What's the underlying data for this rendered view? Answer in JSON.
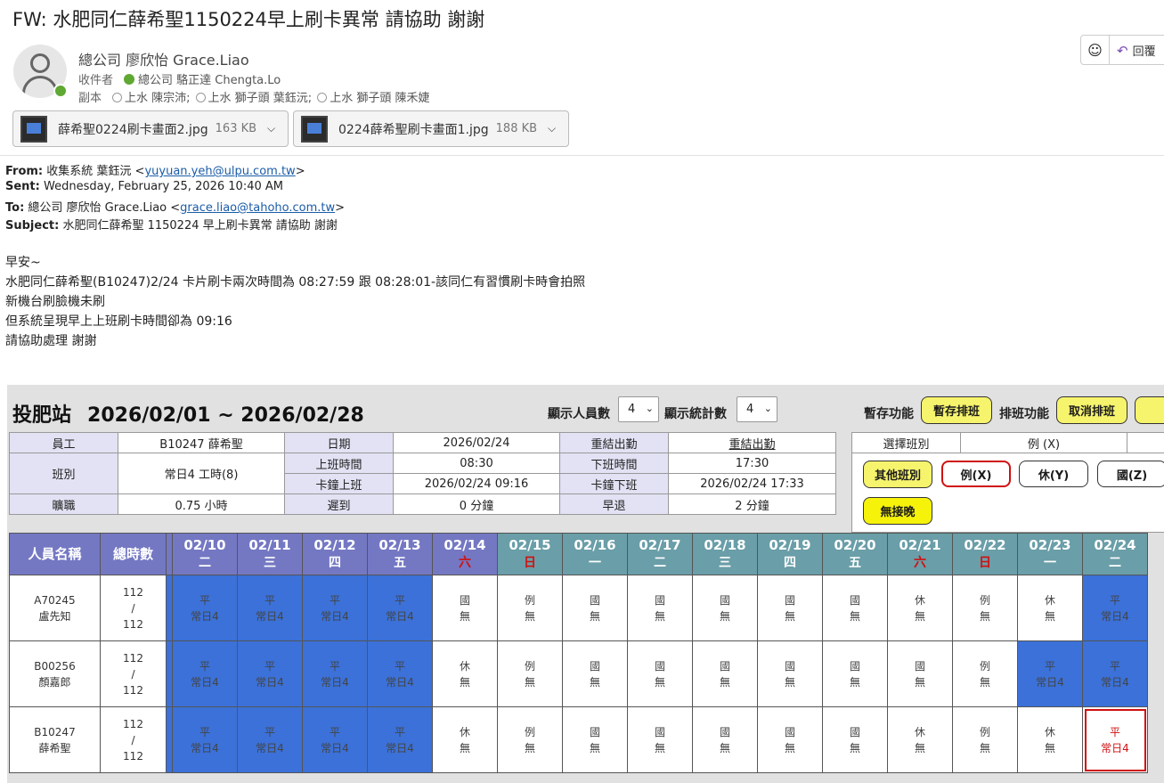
{
  "email": {
    "subject": "FW: 水肥同仁薛希聖1150224早上刷卡異常 請協助 謝謝",
    "sender": "總公司 廖欣怡 Grace.Liao",
    "to_label": "收件者",
    "to": "總公司 駱正達 Chengta.Lo",
    "cc_label": "副本",
    "cc": [
      "上水 陳宗沛;",
      "上水 獅子頭 葉鈺沅;",
      "上水 獅子頭 陳禾婕"
    ],
    "reply_label": "回覆",
    "attachments": [
      {
        "name": "薛希聖0224刷卡畫面2.jpg",
        "size": "163 KB"
      },
      {
        "name": "0224薛希聖刷卡畫面1.jpg",
        "size": "188 KB"
      }
    ],
    "fwd": {
      "from_label": "From:",
      "from_name": "收集系統 葉鈺沅 <",
      "from_email": "yuyuan.yeh@ulpu.com.tw",
      "from_end": ">",
      "sent_label": "Sent:",
      "sent": "Wednesday, February 25, 2026 10:40 AM",
      "to_label": "To:",
      "to_name": "總公司 廖欣怡 Grace.Liao <",
      "to_email": "grace.liao@tahoho.com.tw",
      "to_end": ">",
      "subj_label": "Subject:",
      "subj": "水肥同仁薛希聖 1150224 早上刷卡異常 請協助 謝謝"
    },
    "body": [
      "早安~",
      "水肥同仁薛希聖(B10247)2/24 卡片刷卡兩次時間為 08:27:59 跟 08:28:01-該同仁有習慣刷卡時會拍照",
      "新機台刷臉機未刷",
      "但系統呈現早上上班刷卡時間卻為 09:16",
      "請協助處理 謝謝"
    ]
  },
  "panel": {
    "station": "投肥站",
    "range": "2026/02/01 ~ 2026/02/28",
    "show_people_label": "顯示人員數",
    "show_people_value": "4",
    "show_stats_label": "顯示統計數",
    "show_stats_value": "4",
    "temp_label": "暫存功能",
    "temp_btn": "暫存排班",
    "sched_label": "排班功能",
    "sched_btn": "取消排班",
    "info": {
      "emp_h": "員工",
      "emp": "B10247 薛希聖",
      "date_h": "日期",
      "date": "2026/02/24",
      "reset_h": "重結出勤",
      "reset": "重結出勤",
      "shift_h": "班別",
      "shift": "常日4 工時(8)",
      "on_h": "上班時間",
      "on": "08:30",
      "off_h": "下班時間",
      "off": "17:30",
      "cardon_h": "卡鐘上班",
      "cardon": "2026/02/24 09:16",
      "cardoff_h": "卡鐘下班",
      "cardoff": "2026/02/24 17:33",
      "absent_h": "曠職",
      "absent": "0.75 小時",
      "late_h": "遲到",
      "late": "0 分鐘",
      "early_h": "早退",
      "early": "2 分鐘"
    },
    "select_h": "選擇班別",
    "select_v": "例 (X)",
    "shift_btns": {
      "other": "其他班別",
      "x": "例(X)",
      "y": "休(Y)",
      "z": "國(Z)",
      "night": "無接晚"
    },
    "grid": {
      "name_h": "人員名稱",
      "hours_h": "總時數",
      "dates": [
        {
          "d": "02/10",
          "w": "二"
        },
        {
          "d": "02/11",
          "w": "三"
        },
        {
          "d": "02/12",
          "w": "四"
        },
        {
          "d": "02/13",
          "w": "五"
        },
        {
          "d": "02/14",
          "w": "六"
        },
        {
          "d": "02/15",
          "w": "日"
        },
        {
          "d": "02/16",
          "w": "一"
        },
        {
          "d": "02/17",
          "w": "二"
        },
        {
          "d": "02/18",
          "w": "三"
        },
        {
          "d": "02/19",
          "w": "四"
        },
        {
          "d": "02/20",
          "w": "五"
        },
        {
          "d": "02/21",
          "w": "六"
        },
        {
          "d": "02/22",
          "w": "日"
        },
        {
          "d": "02/23",
          "w": "一"
        },
        {
          "d": "02/24",
          "w": "二"
        }
      ],
      "rows": [
        {
          "id": "A70245",
          "name": "盧先知",
          "h1": "112",
          "slash": "/",
          "h2": "112",
          "cells": [
            [
              "平",
              "常日4"
            ],
            [
              "平",
              "常日4"
            ],
            [
              "平",
              "常日4"
            ],
            [
              "平",
              "常日4"
            ],
            [
              "國",
              "無"
            ],
            [
              "例",
              "無"
            ],
            [
              "國",
              "無"
            ],
            [
              "國",
              "無"
            ],
            [
              "國",
              "無"
            ],
            [
              "國",
              "無"
            ],
            [
              "國",
              "無"
            ],
            [
              "休",
              "無"
            ],
            [
              "例",
              "無"
            ],
            [
              "休",
              "無"
            ],
            [
              "平",
              "常日4"
            ]
          ]
        },
        {
          "id": "B00256",
          "name": "顏嘉郎",
          "h1": "112",
          "slash": "/",
          "h2": "112",
          "cells": [
            [
              "平",
              "常日4"
            ],
            [
              "平",
              "常日4"
            ],
            [
              "平",
              "常日4"
            ],
            [
              "平",
              "常日4"
            ],
            [
              "休",
              "無"
            ],
            [
              "例",
              "無"
            ],
            [
              "國",
              "無"
            ],
            [
              "國",
              "無"
            ],
            [
              "國",
              "無"
            ],
            [
              "國",
              "無"
            ],
            [
              "國",
              "無"
            ],
            [
              "國",
              "無"
            ],
            [
              "例",
              "無"
            ],
            [
              "平",
              "常日4"
            ],
            [
              "平",
              "常日4"
            ]
          ]
        },
        {
          "id": "B10247",
          "name": "薛希聖",
          "h1": "112",
          "slash": "/",
          "h2": "112",
          "cells": [
            [
              "平",
              "常日4"
            ],
            [
              "平",
              "常日4"
            ],
            [
              "平",
              "常日4"
            ],
            [
              "平",
              "常日4"
            ],
            [
              "休",
              "無"
            ],
            [
              "例",
              "無"
            ],
            [
              "國",
              "無"
            ],
            [
              "國",
              "無"
            ],
            [
              "國",
              "無"
            ],
            [
              "國",
              "無"
            ],
            [
              "國",
              "無"
            ],
            [
              "休",
              "無"
            ],
            [
              "例",
              "無"
            ],
            [
              "休",
              "無"
            ],
            [
              "平",
              "常日4"
            ]
          ]
        }
      ]
    }
  }
}
